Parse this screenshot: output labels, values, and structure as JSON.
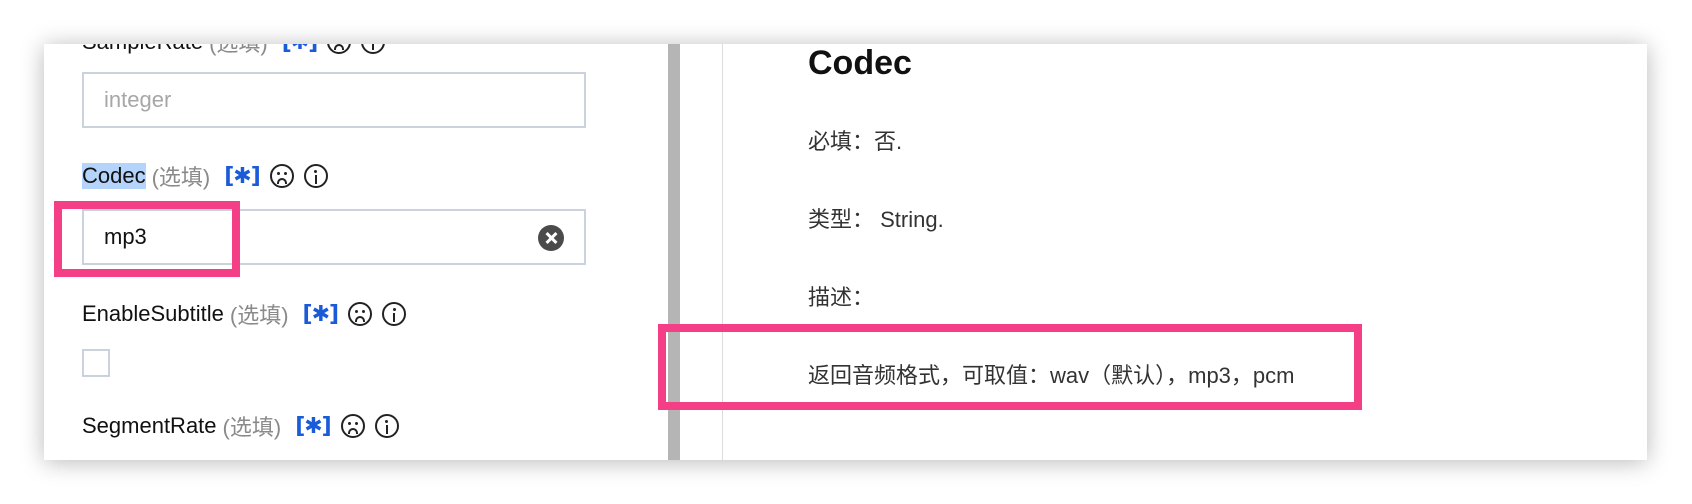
{
  "left_panel": {
    "fields": {
      "sample_rate": {
        "name": "SampleRate",
        "optional": "(选填)",
        "req_icon": "[✱]"
      },
      "sample_rate_input": {
        "placeholder": "integer"
      },
      "codec": {
        "name": "Codec",
        "optional": "(选填)",
        "req_icon": "[✱]",
        "value": "mp3"
      },
      "enable_subtitle": {
        "name": "EnableSubtitle",
        "optional": "(选填)",
        "req_icon": "[✱]"
      },
      "segment_rate": {
        "name": "SegmentRate",
        "optional": "(选填)",
        "req_icon": "[✱]"
      }
    }
  },
  "right_panel": {
    "title": "Codec",
    "required": "必填：否.",
    "type": "类型： String.",
    "description_label": "描述：",
    "description": "返回音频格式，可取值：wav（默认），mp3，pcm"
  },
  "colors": {
    "highlight_box": "#f43f86",
    "required_icon": "#1a5bd8",
    "selection": "#b4d4fb"
  }
}
